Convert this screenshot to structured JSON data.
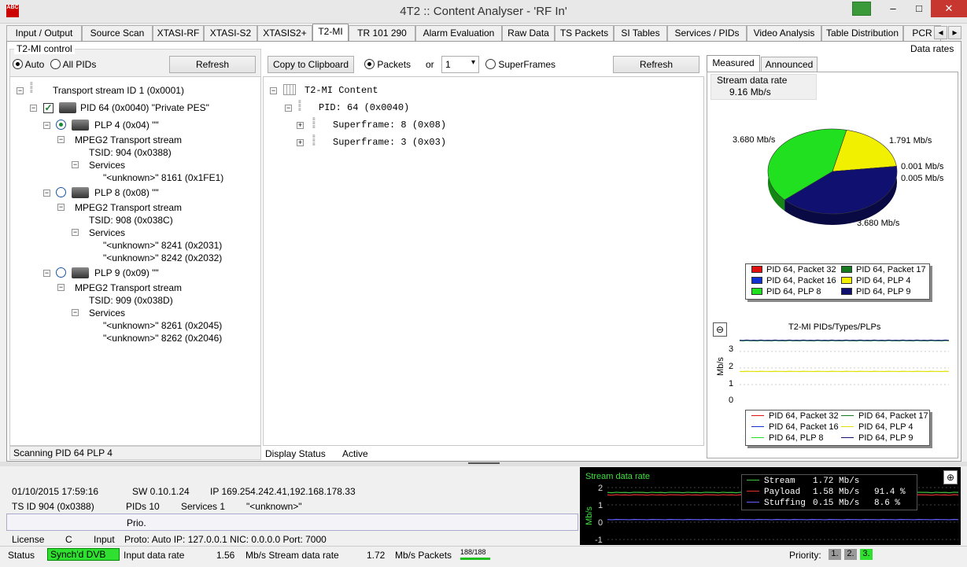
{
  "window": {
    "title": "4T2 :: Content Analyser - 'RF In'",
    "icon_text": "ABC",
    "minimize": "–",
    "maximize": "□",
    "close": "✕"
  },
  "tabs": [
    "Input / Output",
    "Source Scan",
    "XTASI-RF",
    "XTASI-S2",
    "XTASIS2+",
    "T2-MI",
    "TR 101 290",
    "Alarm Evaluation",
    "Raw Data",
    "TS Packets",
    "SI Tables",
    "Services / PIDs",
    "Video Analysis",
    "Table Distribution",
    "PCR"
  ],
  "tab_scroll": {
    "left": "◂",
    "right": "▸"
  },
  "control": {
    "title": "T2-MI control",
    "auto": "Auto",
    "all_pids": "All PIDs",
    "refresh": "Refresh",
    "scan_status": "Scanning PID 64 PLP 4"
  },
  "tree": {
    "ts": "Transport stream ID 1 (0x0001)",
    "pid": "PID 64 (0x0040) \"Private PES\"",
    "plp4": "PLP 4 (0x04) \"\"",
    "plp4_mpeg": "MPEG2 Transport stream",
    "plp4_tsid": "TSID: 904 (0x0388)",
    "plp4_services": "Services",
    "plp4_s1": "\"<unknown>\" 8161 (0x1FE1)",
    "plp8": "PLP 8 (0x08) \"\"",
    "plp8_mpeg": "MPEG2 Transport stream",
    "plp8_tsid": "TSID: 908 (0x038C)",
    "plp8_services": "Services",
    "plp8_s1": "\"<unknown>\" 8241 (0x2031)",
    "plp8_s2": "\"<unknown>\" 8242 (0x2032)",
    "plp9": "PLP 9 (0x09) \"\"",
    "plp9_mpeg": "MPEG2 Transport stream",
    "plp9_tsid": "TSID: 909 (0x038D)",
    "plp9_services": "Services",
    "plp9_s1": "\"<unknown>\" 8261 (0x2045)",
    "plp9_s2": "\"<unknown>\" 8262 (0x2046)"
  },
  "content": {
    "copy": "Copy to Clipboard",
    "packets": "Packets",
    "or": "or",
    "select_value": "1",
    "superframes": "SuperFrames",
    "refresh": "Refresh",
    "root": "T2-MI Content",
    "pid": "PID: 64 (0x0040)",
    "sf1": "Superframe: 8 (0x08)",
    "sf2": "Superframe: 3 (0x03)",
    "display_status_label": "Display Status",
    "display_status_value": "Active"
  },
  "rates": {
    "header": "Data rates",
    "tab_measured": "Measured",
    "tab_announced": "Announced",
    "stream_label": "Stream data rate",
    "stream_value": "9.16 Mb/s",
    "pie_labels": [
      "3.680 Mb/s",
      "1.791 Mb/s",
      "0.001 Mb/s",
      "0.005 Mb/s",
      "3.680 Mb/s"
    ],
    "legend": [
      "PID 64, Packet 32",
      "PID 64, Packet 17",
      "PID 64, Packet 16",
      "PID 64, PLP 4",
      "PID 64, PLP 8",
      "PID 64, PLP 9"
    ],
    "legend_colors": [
      "#e01010",
      "#157a20",
      "#1030d0",
      "#f0f000",
      "#20e020",
      "#101070"
    ],
    "line_title": "T2-MI PIDs/Types/PLPs",
    "line_ylabel": "Mb/s",
    "line_ticks": [
      "3",
      "2",
      "1",
      "0"
    ]
  },
  "info": {
    "datetime": "01/10/2015 17:59:16",
    "sw": "SW  0.10.1.24",
    "ip": "IP  169.254.242.41,192.168.178.33",
    "tsid": "TS ID  904 (0x0388)",
    "pids": "PIDs  10",
    "services": "Services  1",
    "service_name": "\"<unknown>\"",
    "prio": "Prio.",
    "license": "License",
    "license_val": "C",
    "input": "Input",
    "input_val": "Proto: Auto IP: 127.0.0.1 NIC: 0.0.0.0 Port: 7000"
  },
  "osc": {
    "title": "Stream data rate",
    "ylabel": "Mb/s",
    "ticks": [
      "2",
      "1",
      "0",
      "-1"
    ],
    "rows": [
      {
        "name": "Stream",
        "val": "1.72 Mb/s",
        "pct": "",
        "color": "#40c040"
      },
      {
        "name": "Payload",
        "val": "1.58 Mb/s",
        "pct": "91.4 %",
        "color": "#e03030"
      },
      {
        "name": "Stuffing",
        "val": "0.15 Mb/s",
        "pct": "8.6 %",
        "color": "#6060ff"
      }
    ]
  },
  "statusbar": {
    "status": "Status",
    "sync": "Synch'd DVB",
    "input_rate_label": "Input data rate",
    "input_rate": "1.56",
    "stream_rate_label": "Mb/s Stream data rate",
    "stream_rate": "1.72",
    "packets_label": "Mb/s Packets",
    "packets": "188/188",
    "priority": "Priority:",
    "p1": "1.",
    "p2": "2.",
    "p3": "3."
  },
  "chart_data": [
    {
      "type": "pie",
      "title": "",
      "categories": [
        "PID 64, Packet 32",
        "PID 64, Packet 17",
        "PID 64, Packet 16",
        "PID 64, PLP 4",
        "PID 64, PLP 8",
        "PID 64, PLP 9"
      ],
      "values": [
        0.001,
        0.005,
        0.0,
        1.791,
        3.68,
        3.68
      ],
      "unit": "Mb/s"
    },
    {
      "type": "line",
      "title": "T2-MI PIDs/Types/PLPs",
      "ylabel": "Mb/s",
      "ylim": [
        0,
        3.8
      ],
      "series": [
        {
          "name": "PID 64, PLP 8",
          "values": [
            3.65,
            3.63,
            3.66,
            3.64,
            3.65,
            3.63,
            3.66,
            3.64
          ]
        },
        {
          "name": "PID 64, PLP 9",
          "values": [
            3.67,
            3.66,
            3.68,
            3.66,
            3.67,
            3.66,
            3.68,
            3.66
          ]
        },
        {
          "name": "PID 64, PLP 4",
          "values": [
            1.79,
            1.78,
            1.8,
            1.79,
            1.79,
            1.78,
            1.8,
            1.79
          ]
        }
      ],
      "grid": true,
      "legend": "bottom"
    },
    {
      "type": "line",
      "title": "Stream data rate",
      "ylabel": "Mb/s",
      "ylim": [
        -1.2,
        2.4
      ],
      "series": [
        {
          "name": "Stream",
          "values": [
            1.72,
            1.7,
            1.73,
            1.71,
            1.72,
            1.7,
            1.73,
            1.72
          ]
        },
        {
          "name": "Payload",
          "values": [
            1.58,
            1.56,
            1.59,
            1.57,
            1.58,
            1.56,
            1.59,
            1.58
          ]
        },
        {
          "name": "Stuffing",
          "values": [
            0.15,
            0.14,
            0.16,
            0.15,
            0.15,
            0.14,
            0.16,
            0.15
          ]
        }
      ],
      "legend": "top-right"
    }
  ]
}
